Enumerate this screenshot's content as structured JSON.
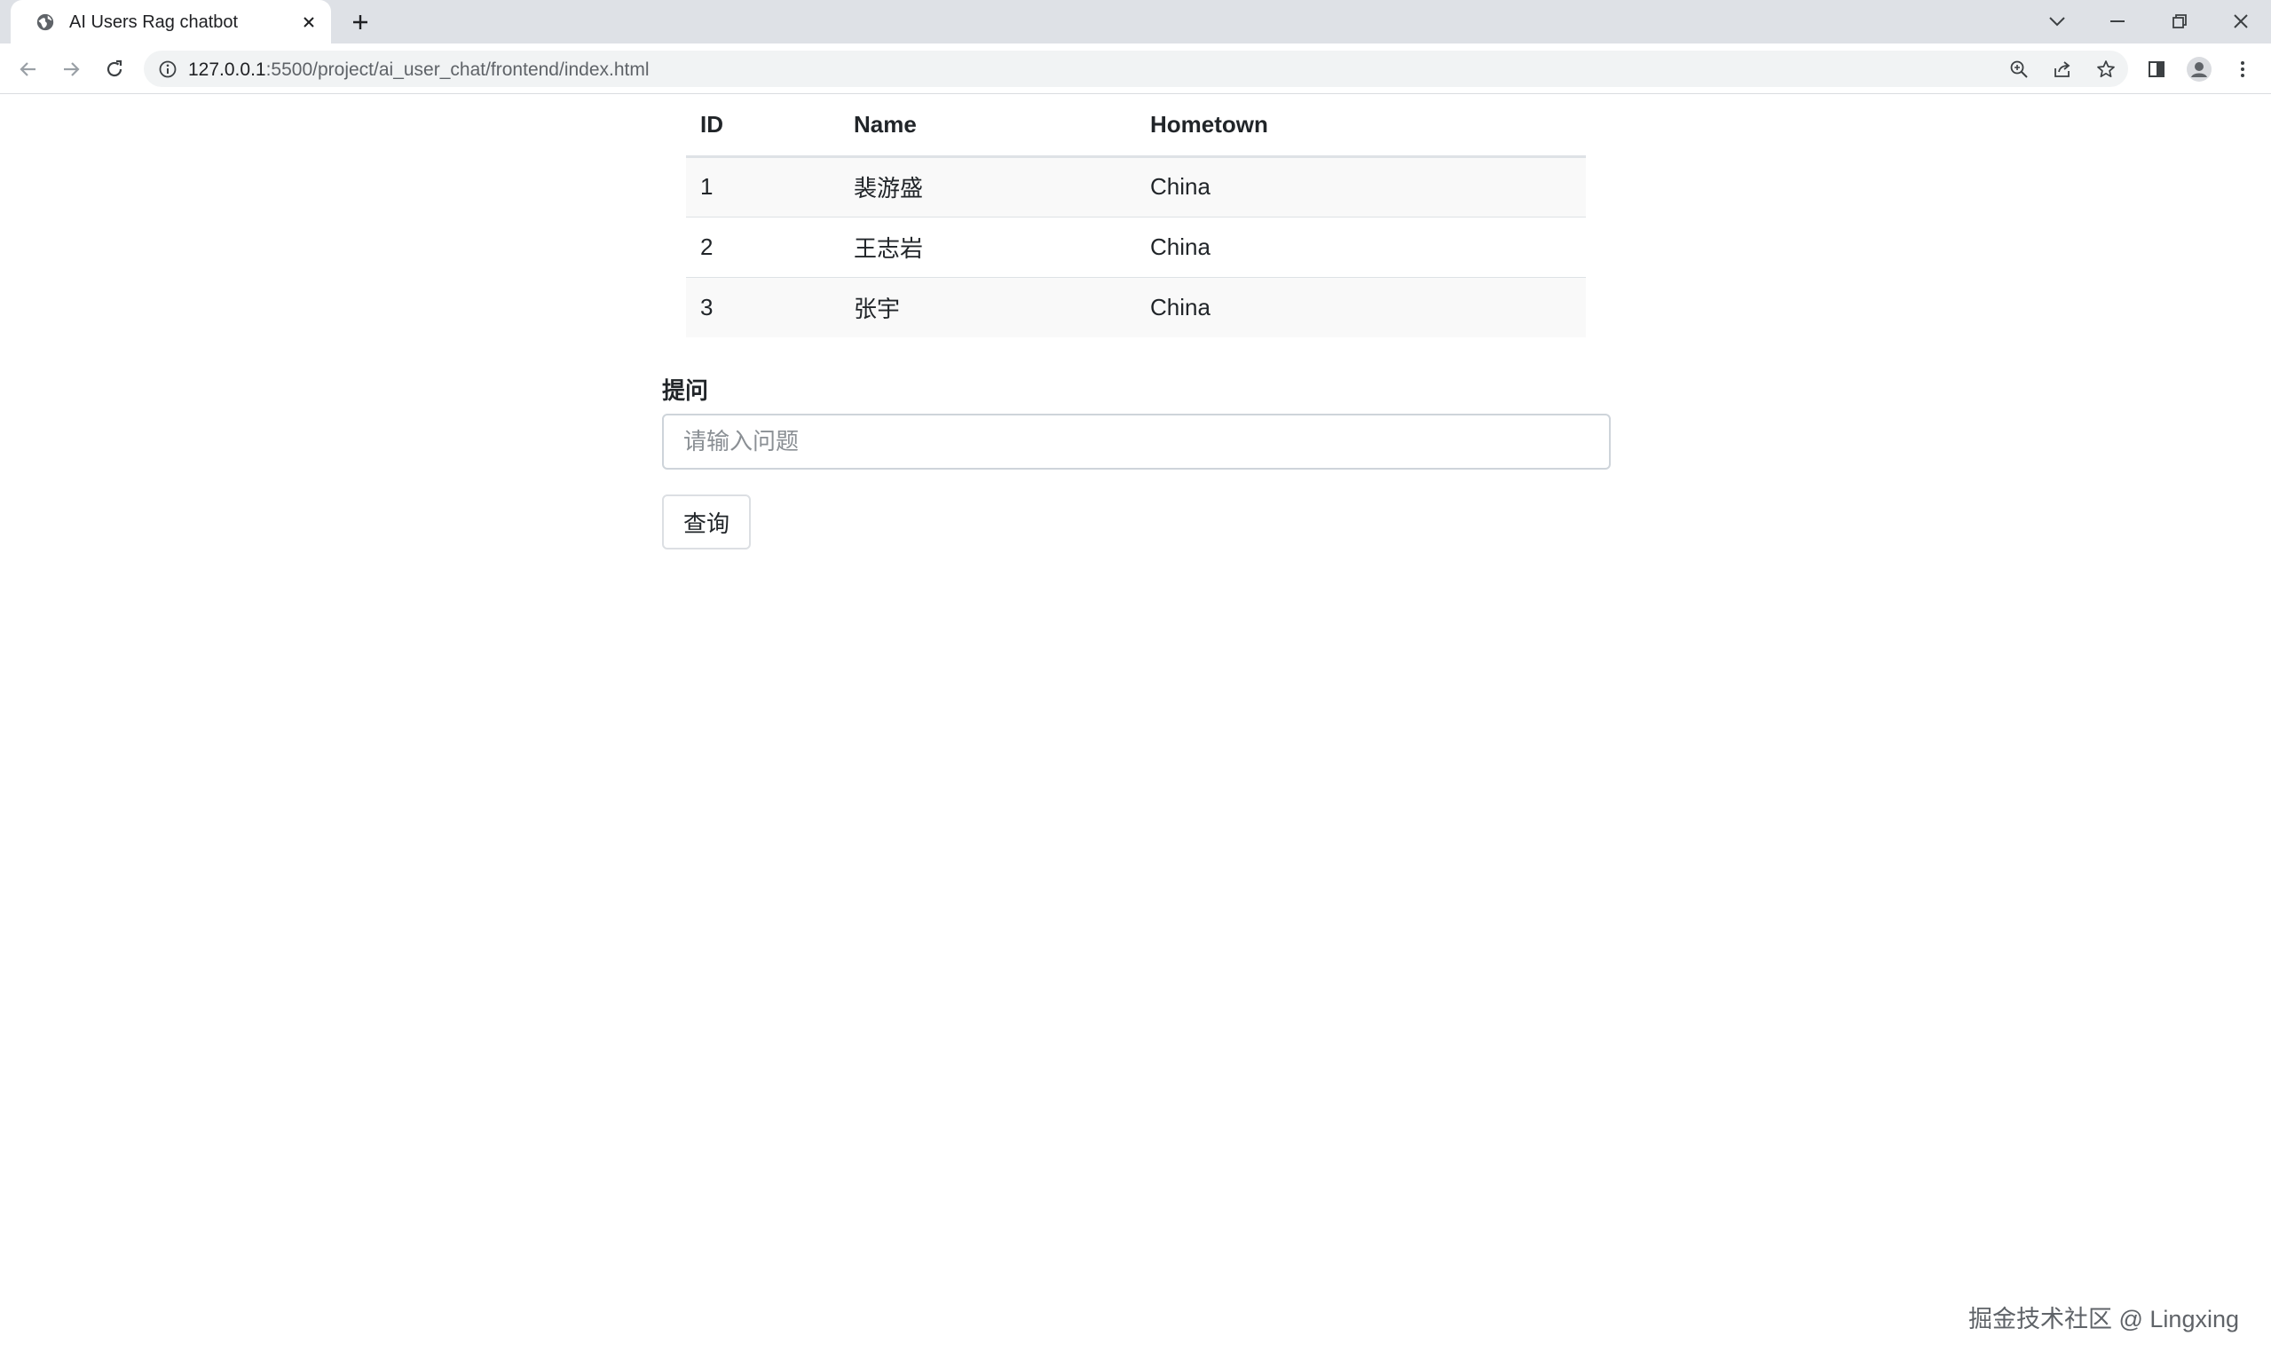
{
  "browser": {
    "tab": {
      "title": "AI Users Rag chatbot"
    },
    "url": {
      "host": "127.0.0.1",
      "path": ":5500/project/ai_user_chat/frontend/index.html"
    }
  },
  "table": {
    "headers": [
      "ID",
      "Name",
      "Hometown"
    ],
    "rows": [
      {
        "id": "1",
        "name": "裴游盛",
        "hometown": "China"
      },
      {
        "id": "2",
        "name": "王志岩",
        "hometown": "China"
      },
      {
        "id": "3",
        "name": "张宇",
        "hometown": "China"
      }
    ]
  },
  "question": {
    "label": "提问",
    "placeholder": "请输入问题",
    "value": "",
    "submit_label": "查询"
  },
  "watermark": "掘金技术社区 @ Lingxing",
  "colors": {
    "tabstrip": "#dee1e6",
    "omnibox": "#f1f3f4",
    "stripe": "#f9f9f9",
    "border": "#dee2e6"
  }
}
